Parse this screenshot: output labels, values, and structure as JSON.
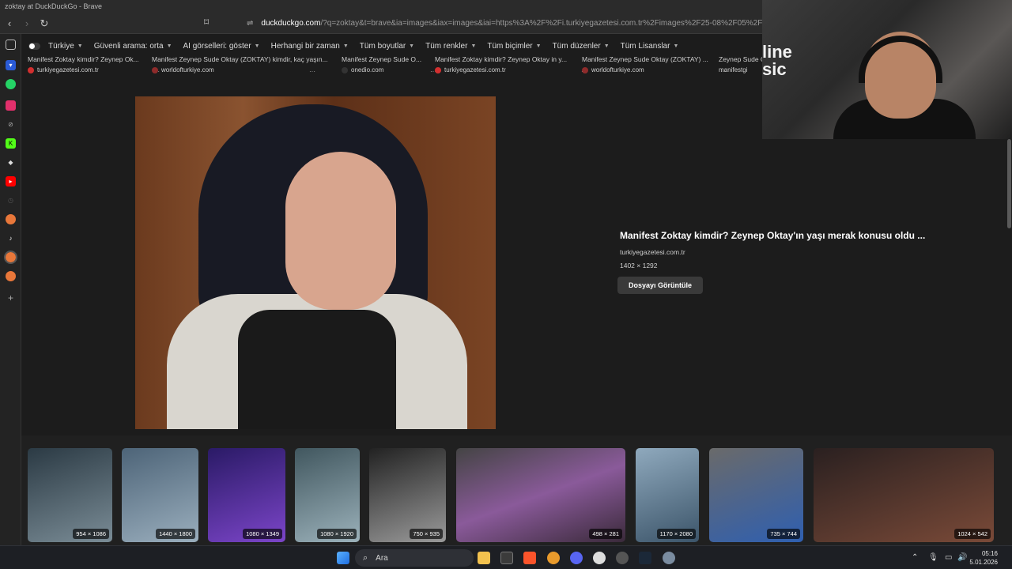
{
  "window": {
    "title": "zoktay at DuckDuckGo - Brave"
  },
  "toolbar": {
    "url_host": "duckduckgo.com",
    "url_rest": "/?q=zoktay&t=brave&ia=images&iax=images&iai=https%3A%2F%2Fi.turkiyegazetesi.com.tr%2Fimages%2F25-08%2F05%2Fmanifest-zo..."
  },
  "filters": {
    "items": [
      "Türkiye",
      "Güvenli arama: orta",
      "AI görselleri: göster",
      "Herhangi bir zaman",
      "Tüm boyutlar",
      "Tüm renkler",
      "Tüm biçimler",
      "Tüm düzenler",
      "Tüm Lisanslar"
    ]
  },
  "sources": [
    {
      "title": "Manifest Zoktay kimdir? Zeynep Ok...",
      "domain": "turkiyegazetesi.com.tr",
      "color": "#d32f2f"
    },
    {
      "title": "Manifest Zeynep Sude Oktay (ZOKTAY) kimdir, kaç yaşın...",
      "domain": "worldofturkiye.com",
      "color": "#8e2b2b"
    },
    {
      "title": "Manifest Zeynep Sude O...",
      "domain": "onedio.com",
      "color": "#333333"
    },
    {
      "title": "Manifest Zoktay kimdir? Zeynep Oktay in y...",
      "domain": "turkiyegazetesi.com.tr",
      "color": "#d32f2f"
    },
    {
      "title": "Manifest Zeynep Sude Oktay (ZOKTAY) ...",
      "domain": "worldofturkiye.com",
      "color": "#8e2b2b"
    },
    {
      "title": "Zeynep Sude O",
      "domain": "manifestgi",
      "color": "#555555"
    }
  ],
  "detail": {
    "title": "Manifest Zoktay kimdir? Zeynep Oktay'ın yaşı merak konusu oldu ...",
    "domain": "turkiyegazetesi.com.tr",
    "size": "1402 × 1292",
    "button": "Dosyayı Görüntüle"
  },
  "thumbnails": [
    {
      "dim": "954 × 1086",
      "color": "#3a4a58"
    },
    {
      "dim": "1440 × 1800",
      "color": "#556a7c"
    },
    {
      "dim": "1080 × 1349",
      "color": "#4b2a86"
    },
    {
      "dim": "1080 × 1920",
      "color": "#5d6f76"
    },
    {
      "dim": "750 × 935",
      "color": "#3a3a3a"
    },
    {
      "dim": "498 × 281",
      "color": "#6a4a6e"
    },
    {
      "dim": "1170 × 2080",
      "color": "#5f7a8f"
    },
    {
      "dim": "735 × 744",
      "color": "#2f4f86"
    },
    {
      "dim": "1024 × 542",
      "color": "#5a3a30"
    }
  ],
  "webcam": {
    "sign_text": "line\nsic"
  },
  "taskbar": {
    "search_label": "Ara",
    "time": "05:16",
    "date": "5.01.2026"
  }
}
